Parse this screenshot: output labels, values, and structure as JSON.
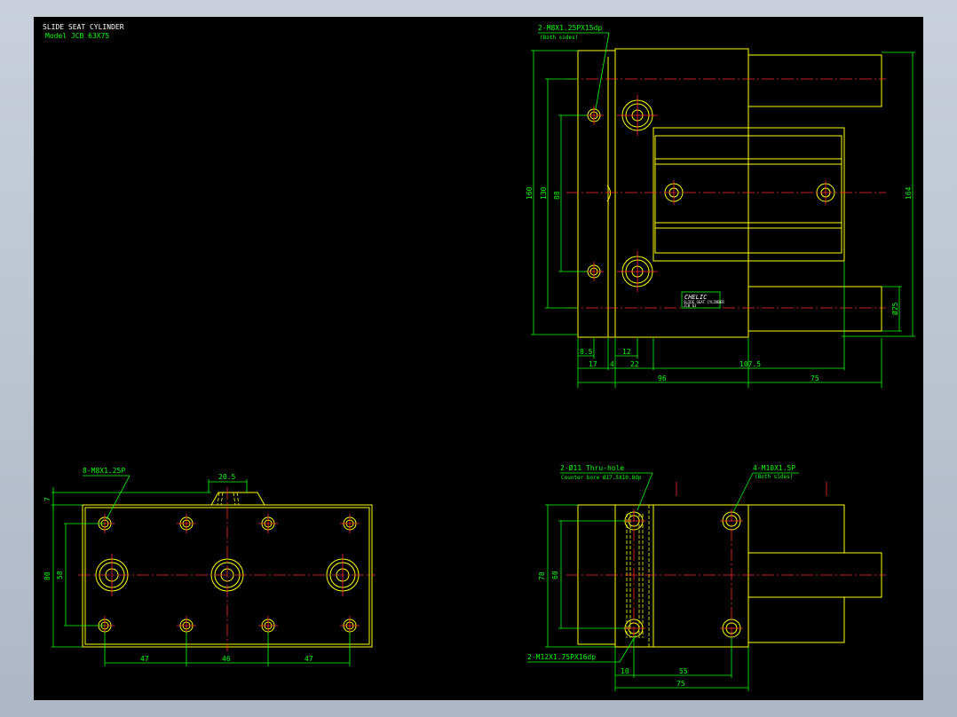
{
  "title": "SLIDE SEAT CYLINDER",
  "model": "Model  JCB 63X75",
  "top_view": {
    "callout": "2-M8X1.25PX15dp",
    "callout_note": "(Both sides)",
    "dim_160": "160",
    "dim_130": "130",
    "dim_88": "88",
    "dim_164": "164",
    "dim_d25": "Ø25",
    "dim_8_5": "8.5",
    "dim_17": "17",
    "dim_4": "4",
    "dim_12": "12",
    "dim_22": "22",
    "dim_107_5": "107.5",
    "dim_96": "96",
    "dim_75": "75",
    "brand": "CHELIC",
    "plate_line1": "SLIDE SEAT CYLINDER",
    "plate_line2": "JCB 63"
  },
  "bottom_left_view": {
    "callout": "8-M8X1.25P",
    "dim_20_5": "20.5",
    "dim_7": "7",
    "dim_80": "80",
    "dim_58": "58",
    "dim_47a": "47",
    "dim_46": "46",
    "dim_47b": "47"
  },
  "bottom_right_view": {
    "callout_top": "2-Ø11  Thru-hole",
    "callout_top2": "Counter bore  Ø17.5X10.8dp",
    "callout_right": "4-M10X1.5P",
    "callout_right_note": "(Both sides)",
    "callout_bottom": "2-M12X1.75PX16dp",
    "dim_78": "78",
    "dim_60": "60",
    "dim_10": "10",
    "dim_55": "55",
    "dim_75": "75"
  },
  "colors": {
    "outline": "#ffff00",
    "dimension": "#00ff00",
    "centerline": "#ff2a2a",
    "background": "#000000"
  }
}
